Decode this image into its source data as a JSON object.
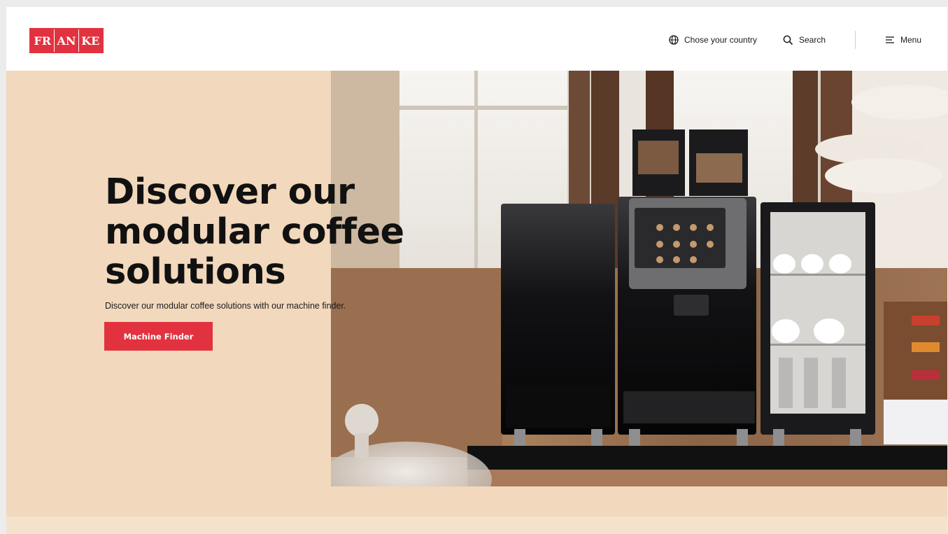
{
  "header": {
    "logo_letters": [
      "FR",
      "AN",
      "KE"
    ],
    "logo_alt": "FRANKE",
    "country_label": "Chose your country",
    "search_label": "Search",
    "menu_label": "Menu"
  },
  "hero": {
    "headline_lines": [
      "Discover our",
      "modular coffee",
      "solutions"
    ],
    "subline": "Discover our modular coffee solutions with our machine finder.",
    "cta_label": "Machine Finder"
  },
  "colors": {
    "brand_red": "#e2323f",
    "hero_background": "#f2d8bc"
  },
  "icons": [
    "globe-icon",
    "search-icon",
    "menu-icon"
  ]
}
